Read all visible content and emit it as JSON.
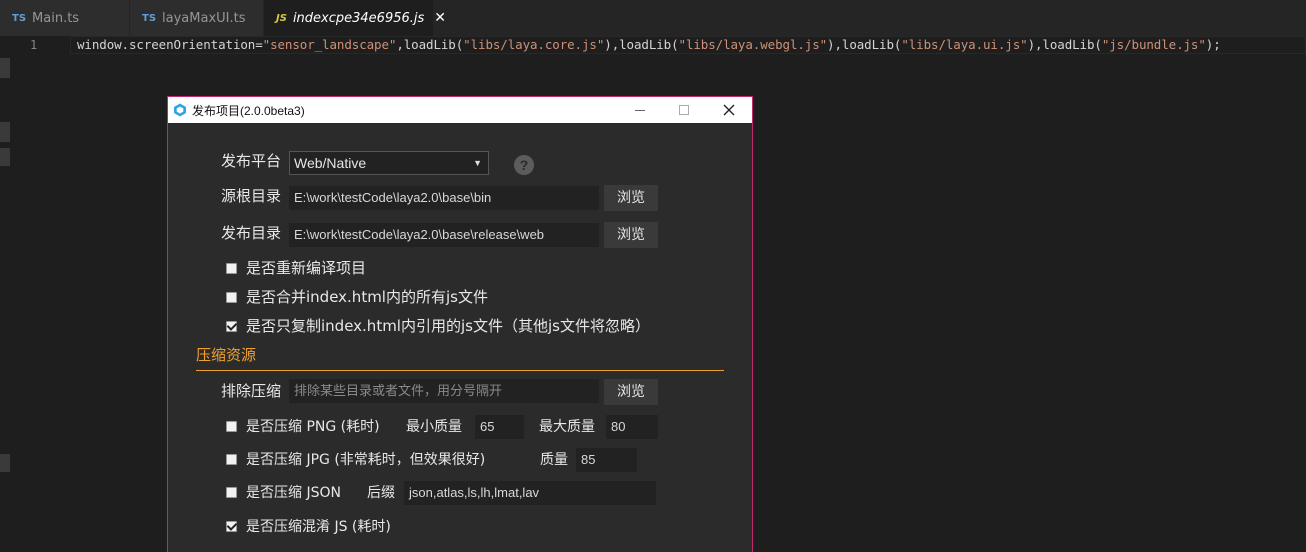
{
  "tabs": [
    {
      "badge": "TS",
      "name": "Main.ts"
    },
    {
      "badge": "TS",
      "name": "layaMaxUI.ts"
    },
    {
      "badge": "JS",
      "name": "indexcpe34e6956.js",
      "close": "✕"
    }
  ],
  "editor": {
    "line_number": "1",
    "code": {
      "p1": "window.screenOrientation=",
      "s1": "\"sensor_landscape\"",
      "p2": ",loadLib(",
      "s2": "\"libs/laya.core.js\"",
      "p3": "),loadLib(",
      "s3": "\"libs/laya.webgl.js\"",
      "p4": "),loadLib(",
      "s4": "\"libs/laya.ui.js\"",
      "p5": "),loadLib(",
      "s5": "\"js/bundle.js\"",
      "p6": ");"
    }
  },
  "dialog": {
    "title": "发布项目(2.0.0beta3)",
    "platform_label": "发布平台",
    "platform_value": "Web/Native",
    "help": "?",
    "source_label": "源根目录",
    "source_value": "E:\\work\\testCode\\laya2.0\\base\\bin",
    "browse": "浏览",
    "publish_label": "发布目录",
    "publish_value": "E:\\work\\testCode\\laya2.0\\base\\release\\web",
    "opt_recompile": "是否重新编译项目",
    "opt_merge": "是否合并index.html内的所有js文件",
    "opt_copy_only": "是否只复制index.html内引用的js文件（其他js文件将忽略）",
    "compress_section": "压缩资源",
    "exclude_label": "排除压缩",
    "exclude_placeholder": "排除某些目录或者文件，用分号隔开",
    "png_label": "是否压缩 PNG (耗时)",
    "png_min_label": "最小质量",
    "png_min_value": "65",
    "png_max_label": "最大质量",
    "png_max_value": "80",
    "jpg_label": "是否压缩 JPG (非常耗时，但效果很好)",
    "jpg_quality_label": "质量",
    "jpg_quality_value": "85",
    "json_label": "是否压缩 JSON",
    "json_suffix_label": "后缀",
    "json_suffix_value": "json,atlas,ls,lh,lmat,lav",
    "js_label": "是否压缩混淆 JS (耗时)"
  }
}
